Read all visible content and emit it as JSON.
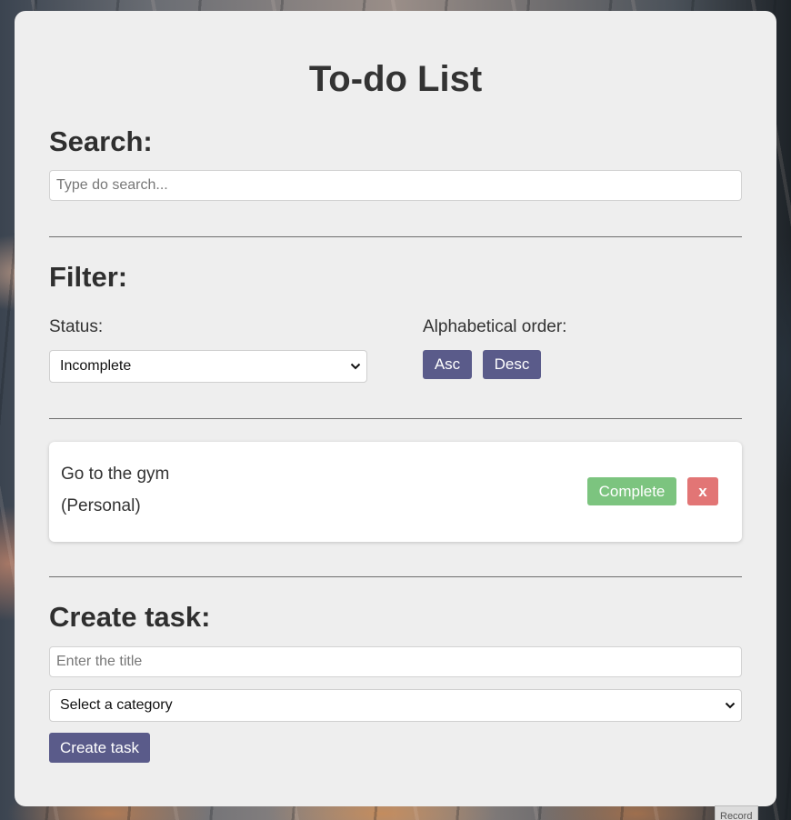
{
  "page": {
    "title": "To-do List"
  },
  "search": {
    "heading": "Search:",
    "placeholder": "Type do search..."
  },
  "filter": {
    "heading": "Filter:",
    "status_label": "Status:",
    "status_selected": "Incomplete",
    "order_label": "Alphabetical order:",
    "asc_label": "Asc",
    "desc_label": "Desc"
  },
  "tasks": [
    {
      "title": "Go to the gym",
      "category": "(Personal)",
      "complete_label": "Complete",
      "remove_label": "x"
    }
  ],
  "create": {
    "heading": "Create task:",
    "title_placeholder": "Enter the title",
    "category_selected": "Select a category",
    "submit_label": "Create task"
  },
  "overlay": {
    "record_label": "Record"
  },
  "colors": {
    "primary_button": "#5a5b8a",
    "complete_button": "#7cc47f",
    "remove_button": "#e27575",
    "card_background": "#eeeeee"
  },
  "icons": {
    "select_arrow": "chevron-down-icon"
  }
}
